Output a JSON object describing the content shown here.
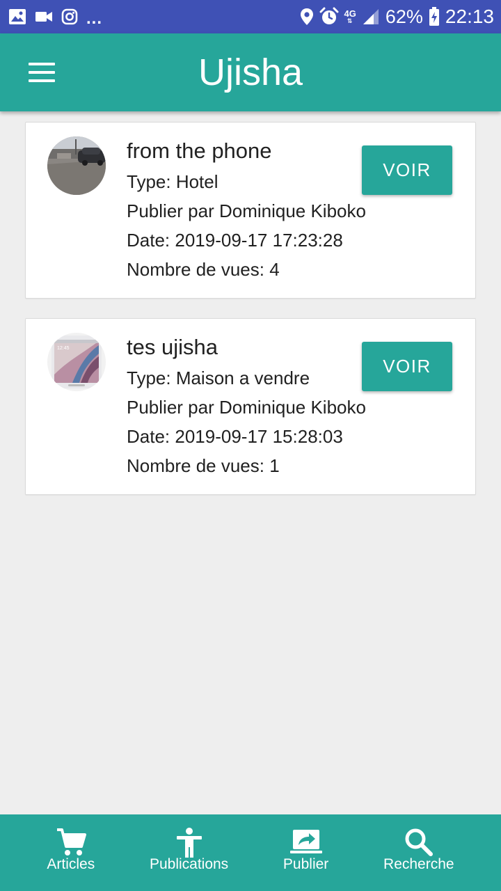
{
  "status_bar": {
    "left_icons": [
      "image-icon",
      "video-camera-icon",
      "instagram-icon"
    ],
    "overflow": "...",
    "right_icons": [
      "location-pin-icon",
      "alarm-icon",
      "signal-icon",
      "battery-charging-icon"
    ],
    "network": "4G",
    "battery": "62%",
    "time": "22:13",
    "color": "#3f51b5"
  },
  "app_bar": {
    "title": "Ujisha",
    "menu_icon": "hamburger-menu-icon",
    "color": "#26a69a"
  },
  "posts": [
    {
      "title": "from the phone",
      "type": "Type: Hotel",
      "author": "Publier par Dominique Kiboko",
      "date": "Date: 2019-09-17 17:23:28",
      "views": "Nombre de vues: 4",
      "button": "VOIR",
      "thumbnail": "street-photo-thumbnail"
    },
    {
      "title": "tes ujisha",
      "type": "Type: Maison a vendre",
      "author": "Publier par Dominique Kiboko",
      "date": "Date: 2019-09-17 15:28:03",
      "views": "Nombre de vues: 1",
      "button": "VOIR",
      "thumbnail": "phone-screenshot-thumbnail"
    }
  ],
  "bottom_nav": {
    "items": [
      {
        "label": "Articles",
        "icon": "shopping-cart-icon"
      },
      {
        "label": "Publications",
        "icon": "person-icon"
      },
      {
        "label": "Publier",
        "icon": "share-laptop-icon"
      },
      {
        "label": "Recherche",
        "icon": "search-icon"
      }
    ],
    "color": "#26a69a"
  }
}
